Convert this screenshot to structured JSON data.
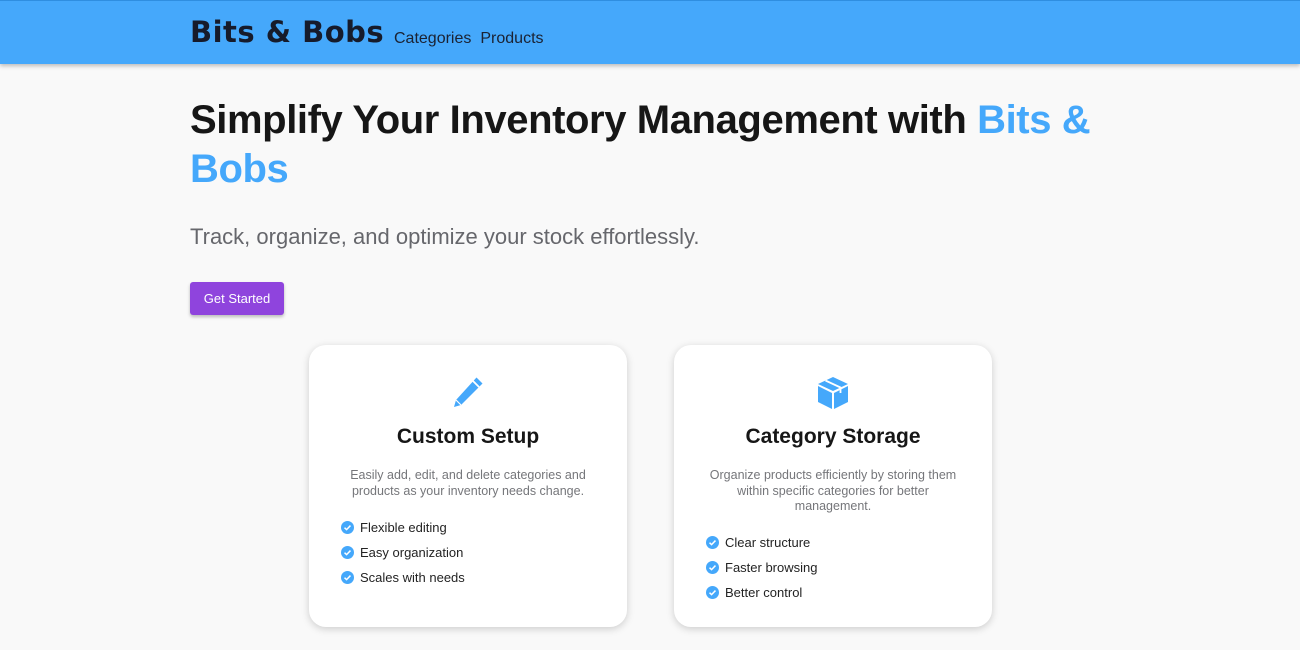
{
  "nav": {
    "brand": "Bits & Bobs",
    "links": [
      {
        "label": "Categories"
      },
      {
        "label": "Products"
      }
    ]
  },
  "hero": {
    "title_main": "Simplify Your Inventory Management with ",
    "title_accent": "Bits & Bobs",
    "subtitle": "Track, organize, and optimize your stock effortlessly.",
    "cta_label": "Get Started"
  },
  "cards": [
    {
      "icon": "pencil-icon",
      "title": "Custom Setup",
      "description": "Easily add, edit, and delete categories and products as your inventory needs change.",
      "features": [
        "Flexible editing",
        "Easy organization",
        "Scales with needs"
      ]
    },
    {
      "icon": "cube-icon",
      "title": "Category Storage",
      "description": "Organize products efficiently by storing them within specific categories for better management.",
      "features": [
        "Clear structure",
        "Faster browsing",
        "Better control"
      ]
    }
  ],
  "colors": {
    "navbar": "#45a8fb",
    "accent": "#45a8fb",
    "cta": "#8f44dd",
    "page_background": "#f9f9f9",
    "check": "#45a8fb"
  }
}
